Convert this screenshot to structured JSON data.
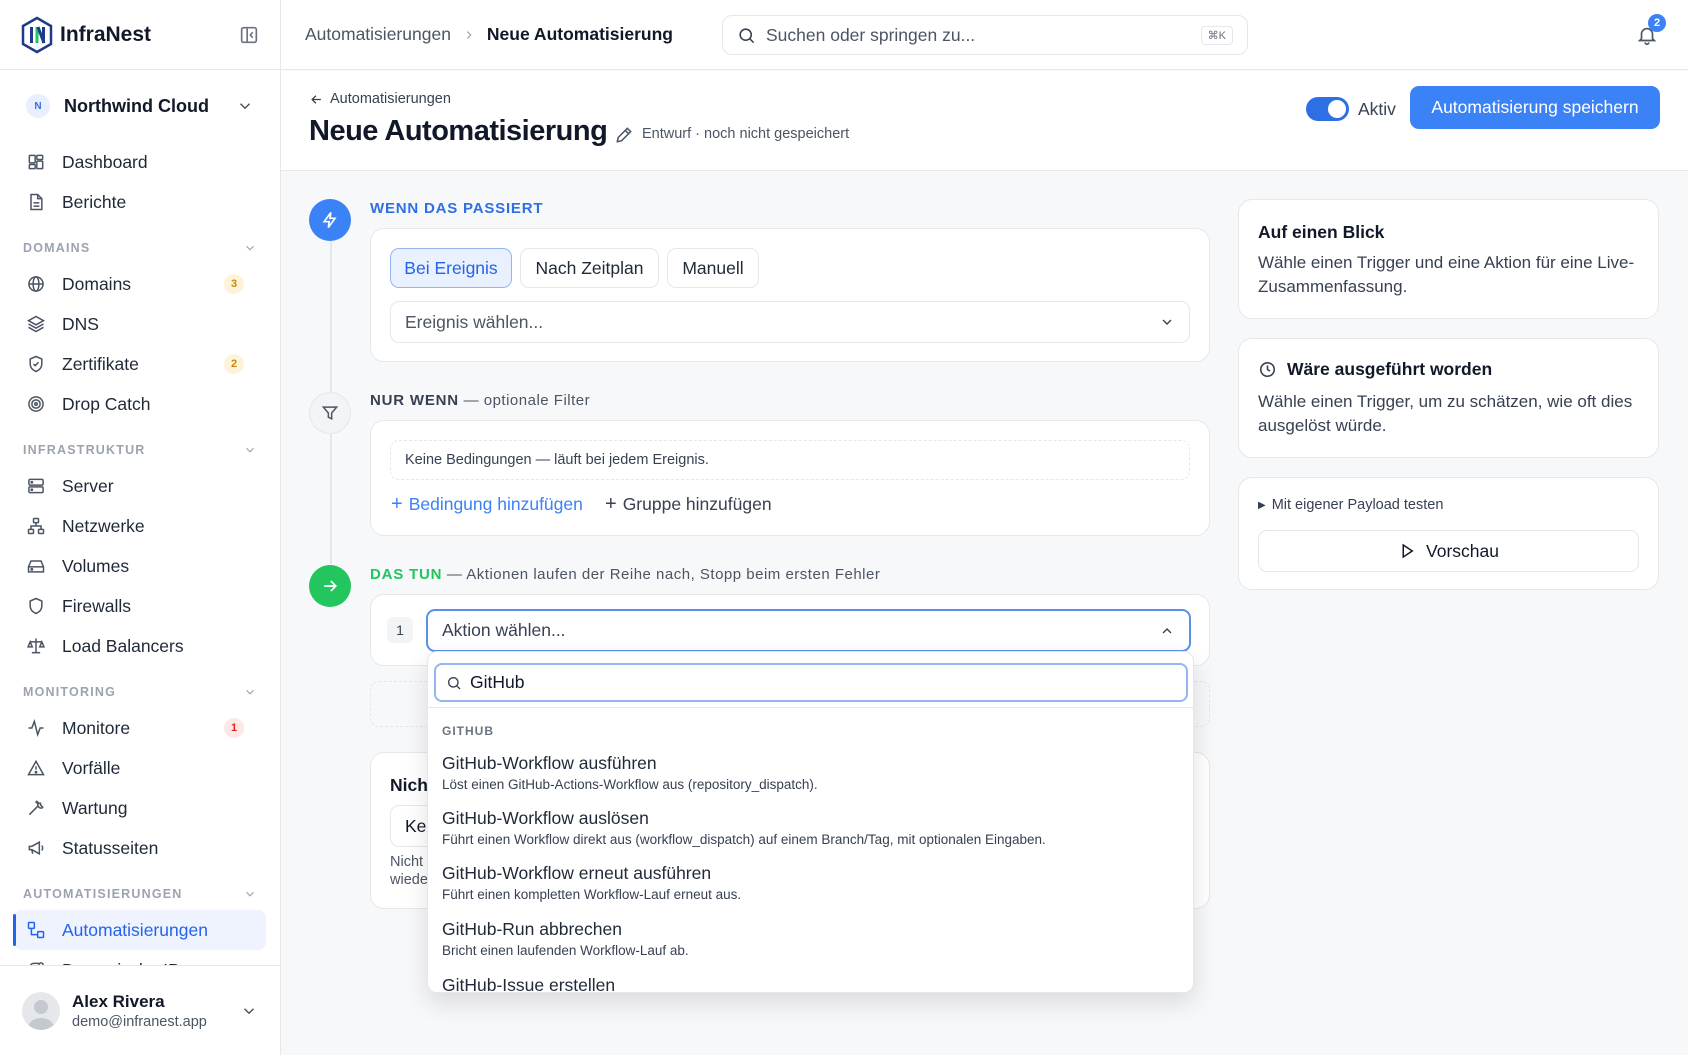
{
  "brand": {
    "name": "InfraNest"
  },
  "workspace": {
    "initial": "N",
    "name": "Northwind Cloud"
  },
  "nav": {
    "top": [
      {
        "label": "Dashboard"
      },
      {
        "label": "Berichte"
      }
    ],
    "sections": {
      "domains": {
        "title": "DOMAINS",
        "items": [
          {
            "label": "Domains",
            "badge": "3"
          },
          {
            "label": "DNS"
          },
          {
            "label": "Zertifikate",
            "badge": "2"
          },
          {
            "label": "Drop Catch"
          }
        ]
      },
      "infra": {
        "title": "INFRASTRUKTUR",
        "items": [
          {
            "label": "Server"
          },
          {
            "label": "Netzwerke"
          },
          {
            "label": "Volumes"
          },
          {
            "label": "Firewalls"
          },
          {
            "label": "Load Balancers"
          }
        ]
      },
      "monitoring": {
        "title": "MONITORING",
        "items": [
          {
            "label": "Monitore",
            "badge": "1"
          },
          {
            "label": "Vorfälle"
          },
          {
            "label": "Wartung"
          },
          {
            "label": "Statusseiten"
          }
        ]
      },
      "automation": {
        "title": "AUTOMATISIERUNGEN",
        "items": [
          {
            "label": "Automatisierungen"
          },
          {
            "label": "Dynamische IPs"
          }
        ]
      }
    }
  },
  "user": {
    "name": "Alex Rivera",
    "email": "demo@infranest.app"
  },
  "topbar": {
    "breadcrumb": [
      "Automatisierungen",
      "Neue Automatisierung"
    ],
    "search_placeholder": "Suchen oder springen zu...",
    "search_shortcut": "⌘K",
    "notifications": "2"
  },
  "header": {
    "back_label": "Automatisierungen",
    "title": "Neue Automatisierung",
    "draft_note": "Entwurf · noch nicht gespeichert",
    "toggle_label": "Aktiv",
    "toggle_on": true,
    "save_label": "Automatisierung speichern"
  },
  "trigger": {
    "label": "WENN DAS PASSIERT",
    "options": [
      "Bei Ereignis",
      "Nach Zeitplan",
      "Manuell"
    ],
    "selected": "Bei Ereignis",
    "event_placeholder": "Ereignis wählen..."
  },
  "filter": {
    "label": "NUR WENN",
    "sublabel": " — optionale Filter",
    "empty": "Keine Bedingungen — läuft bei jedem Ereignis.",
    "add_condition": "Bedingung hinzufügen",
    "add_group": "Gruppe hinzufügen"
  },
  "actions": {
    "label": "DAS TUN",
    "sublabel": " — Aktionen laufen der Reihe nach, Stopp beim ersten Fehler",
    "step_number": "1",
    "action_placeholder": "Aktion wählen...",
    "hidden_card_title": "Nich",
    "hidden_card_field": "Ke",
    "hidden_card_text1": "Nicht",
    "hidden_card_text2": "wiede"
  },
  "dropdown": {
    "search_value": "GitHub",
    "group": "GITHUB",
    "items": [
      {
        "title": "GitHub-Workflow ausführen",
        "desc": "Löst einen GitHub-Actions-Workflow aus (repository_dispatch)."
      },
      {
        "title": "GitHub-Workflow auslösen",
        "desc": "Führt einen Workflow direkt aus (workflow_dispatch) auf einem Branch/Tag, mit optionalen Eingaben."
      },
      {
        "title": "GitHub-Workflow erneut ausführen",
        "desc": "Führt einen kompletten Workflow-Lauf erneut aus."
      },
      {
        "title": "GitHub-Run abbrechen",
        "desc": "Bricht einen laufenden Workflow-Lauf ab."
      },
      {
        "title": "GitHub-Issue erstellen",
        "desc": ""
      }
    ]
  },
  "summary": {
    "title": "Auf einen Blick",
    "text": "Wähle einen Trigger und eine Aktion für eine Live-Zusammenfassung."
  },
  "would_run": {
    "title": "Wäre ausgeführt worden",
    "text": "Wähle einen Trigger, um zu schätzen, wie oft dies ausgelöst würde."
  },
  "test": {
    "toggle_label": "Mit eigener Payload testen",
    "preview_label": "Vorschau"
  },
  "colors": {
    "accent": "#3b82f6",
    "success": "#22c55e",
    "badge_warn": "#c98a0a",
    "badge_err": "#dc2626"
  }
}
